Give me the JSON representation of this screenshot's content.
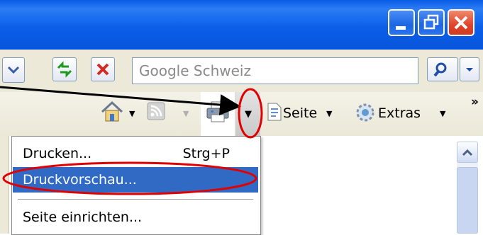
{
  "search": {
    "placeholder": "Google Schweiz"
  },
  "toolbar": {
    "page_label": "Seite",
    "tools_label": "Extras",
    "overflow": "»"
  },
  "print_menu": {
    "items": [
      {
        "label": "Drucken...",
        "shortcut": "Strg+P"
      },
      {
        "label": "Druckvorschau...",
        "shortcut": ""
      },
      {
        "label": "Seite einrichten...",
        "shortcut": ""
      }
    ]
  },
  "colors": {
    "title_blue": "#0a5de6",
    "selection": "#316ac5",
    "highlight_ellipse": "#e00000"
  }
}
